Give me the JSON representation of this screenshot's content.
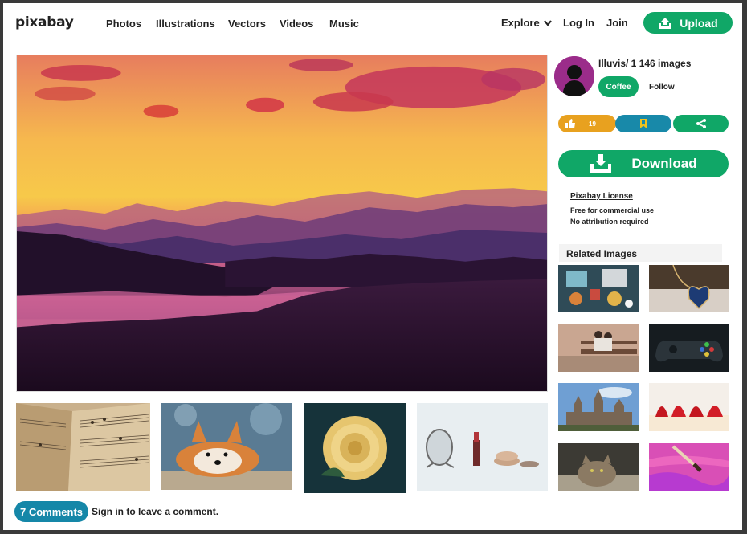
{
  "header": {
    "logo": "pixabay",
    "nav": [
      "Photos",
      "Illustrations",
      "Vectors",
      "Videos",
      "Music"
    ],
    "explore_label": "Explore",
    "login_label": "Log In",
    "join_label": "Join",
    "upload_label": "Upload"
  },
  "author": {
    "line": "Illuvis/ 1 146 images",
    "coffee_label": "Coffee",
    "follow_label": "Follow"
  },
  "actions": {
    "like_count": "19"
  },
  "download": {
    "label": "Download"
  },
  "license": {
    "link": "Pixabay License",
    "line1": "Free for commercial use",
    "line2": "No attribution required"
  },
  "related": {
    "heading": "Related Images",
    "items": [
      "toys-on-table",
      "heart-necklace",
      "couple-on-bench",
      "game-controller",
      "castle",
      "strawberry-dessert",
      "tabby-cat",
      "paint-brush"
    ]
  },
  "thumbnails": [
    "sheet-music",
    "corgi-dog",
    "yellow-rose",
    "cosmetics"
  ],
  "comments": {
    "button_label": "7 Comments",
    "prompt": "Sign in to leave a comment."
  },
  "colors": {
    "green": "#10a767",
    "blue": "#1889a9",
    "orange": "#e8a11f",
    "comments_blue": "#1587a8"
  }
}
